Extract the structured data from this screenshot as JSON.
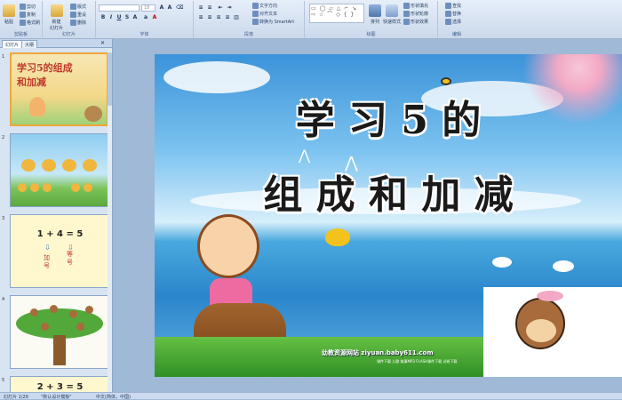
{
  "ribbon": {
    "clipboard": {
      "paste": "粘贴",
      "cut": "剪切",
      "copy": "复制",
      "format_painter": "格式刷",
      "label": "剪贴板"
    },
    "slides": {
      "new_slide": "新建\n幻灯片",
      "layout": "版式",
      "reset": "重设",
      "delete": "删除",
      "label": "幻灯片"
    },
    "font": {
      "font_name": "",
      "font_size": "18",
      "label": "字体"
    },
    "paragraph": {
      "text_direction": "文字方向",
      "align_text": "对齐文本",
      "smartart": "转换为 SmartArt",
      "label": "段落"
    },
    "drawing": {
      "arrange": "排列",
      "quick_styles": "快速样式",
      "shape_fill": "形状填充",
      "shape_outline": "形状轮廓",
      "shape_effects": "形状效果",
      "label": "绘图"
    },
    "editing": {
      "find": "查找",
      "replace": "替换",
      "select": "选择",
      "label": "编辑"
    }
  },
  "panel": {
    "tabs": [
      "幻灯片",
      "大纲"
    ],
    "thumbnails": [
      {
        "num": "1",
        "text": "学习5的组成和加减"
      },
      {
        "num": "2",
        "text": ""
      },
      {
        "num": "3",
        "text_eq": "1 + 4 = 5",
        "text_a": "加\n号",
        "text_b": "等\n号"
      },
      {
        "num": "4",
        "text": ""
      },
      {
        "num": "5",
        "text": "2 + 3 = 5"
      }
    ]
  },
  "slide": {
    "title_line1": "学 习 5 的",
    "title_line2": "组 成 和 加 减",
    "site_text": "幼教资源网站  ziyuan.baby611.com",
    "site_sub": "课件下载  儿歌  故事MP3  FLASH课件下载  试卷下载"
  },
  "status": {
    "slide_info": "幻灯片 1/29",
    "theme": "\"默认设计模板\"",
    "language": "中文(简体，中国)"
  },
  "colors": {
    "accent": "#2b86cb",
    "title": "#1a1a1a"
  }
}
